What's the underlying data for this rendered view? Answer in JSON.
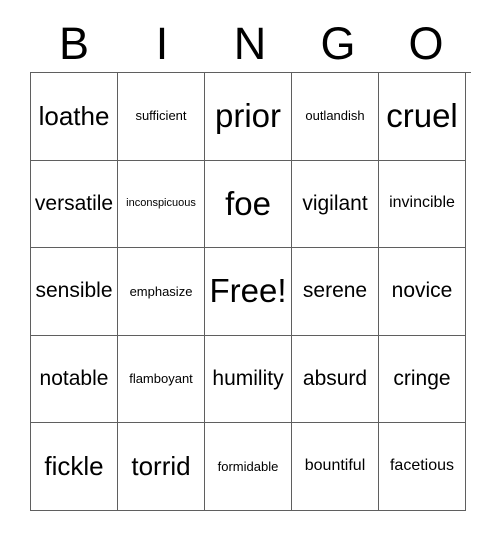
{
  "card": {
    "title": "BINGO",
    "headers": [
      "B",
      "I",
      "N",
      "G",
      "O"
    ],
    "free_space_label": "Free!",
    "colors": {
      "border": "#5f5f5f",
      "text": "#000000",
      "background": "#ffffff"
    },
    "rows": [
      [
        {
          "text": "loathe",
          "size": "lg"
        },
        {
          "text": "sufficient",
          "size": "xs"
        },
        {
          "text": "prior",
          "size": "xl"
        },
        {
          "text": "outlandish",
          "size": "xs"
        },
        {
          "text": "cruel",
          "size": "xl"
        }
      ],
      [
        {
          "text": "versatile",
          "size": "md"
        },
        {
          "text": "inconspicuous",
          "size": "xxs"
        },
        {
          "text": "foe",
          "size": "xl"
        },
        {
          "text": "vigilant",
          "size": "md"
        },
        {
          "text": "invincible",
          "size": "sm"
        }
      ],
      [
        {
          "text": "sensible",
          "size": "md"
        },
        {
          "text": "emphasize",
          "size": "xs"
        },
        {
          "text": "Free!",
          "size": "xl"
        },
        {
          "text": "serene",
          "size": "md"
        },
        {
          "text": "novice",
          "size": "md"
        }
      ],
      [
        {
          "text": "notable",
          "size": "md"
        },
        {
          "text": "flamboyant",
          "size": "xs"
        },
        {
          "text": "humility",
          "size": "md"
        },
        {
          "text": "absurd",
          "size": "md"
        },
        {
          "text": "cringe",
          "size": "md"
        }
      ],
      [
        {
          "text": "fickle",
          "size": "lg"
        },
        {
          "text": "torrid",
          "size": "lg"
        },
        {
          "text": "formidable",
          "size": "xs"
        },
        {
          "text": "bountiful",
          "size": "sm"
        },
        {
          "text": "facetious",
          "size": "sm"
        }
      ]
    ]
  }
}
